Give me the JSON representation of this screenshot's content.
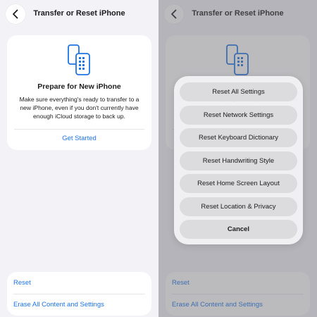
{
  "nav": {
    "title": "Transfer or Reset iPhone",
    "back_icon": "chevron-left-icon"
  },
  "prepare": {
    "icon": "iphone-transfer-icon",
    "title": "Prepare for New iPhone",
    "body": "Make sure everything's ready to transfer to a new iPhone, even if you don't currently have enough iCloud storage to back up.",
    "action": "Get Started"
  },
  "bottom": {
    "reset": "Reset",
    "erase": "Erase All Content and Settings"
  },
  "reset_sheet": {
    "options": [
      "Reset All Settings",
      "Reset Network Settings",
      "Reset Keyboard Dictionary",
      "Reset Handwriting Style",
      "Reset Home Screen Layout",
      "Reset Location & Privacy"
    ],
    "cancel": "Cancel"
  },
  "colors": {
    "accent": "#1e74e4",
    "background": "#f2f2f7",
    "card": "#ffffff"
  }
}
